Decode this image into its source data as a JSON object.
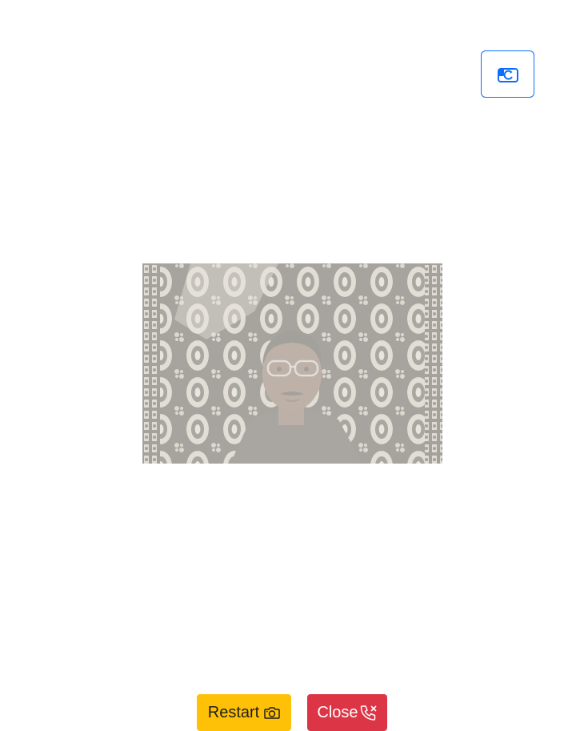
{
  "header": {
    "switch_camera_icon": "camera-switch-icon",
    "accent_color": "#0d6efd"
  },
  "video": {
    "feed": "live-camera-feed"
  },
  "controls": {
    "restart_label": "Restart",
    "restart_icon": "camera-icon",
    "restart_color": "#ffc107",
    "close_label": "Close",
    "close_icon": "phone-x-icon",
    "close_color": "#dc3545"
  }
}
